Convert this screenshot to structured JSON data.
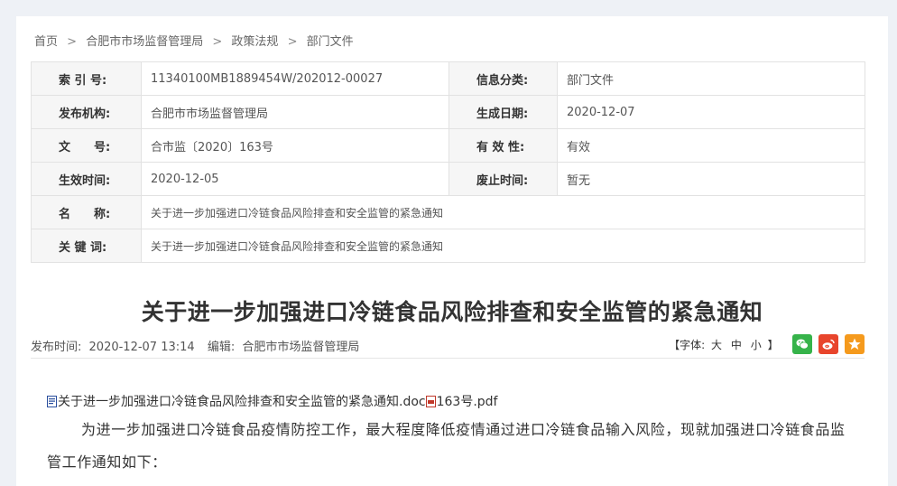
{
  "breadcrumb": {
    "home": "首页",
    "sep": ">",
    "items": [
      "合肥市市场监督管理局",
      "政策法规",
      "部门文件"
    ]
  },
  "meta": {
    "index_label": "索 引 号:",
    "index_value": "11340100MB1889454W/202012-00027",
    "category_label": "信息分类:",
    "category_value": "部门文件",
    "publisher_label": "发布机构:",
    "publisher_value": "合肥市市场监督管理局",
    "created_label": "生成日期:",
    "created_value": "2020-12-07",
    "docno_label": "文　　号:",
    "docno_value": "合市监〔2020〕163号",
    "validity_label": "有 效 性:",
    "validity_value": "有效",
    "effective_label": "生效时间:",
    "effective_value": "2020-12-05",
    "abolish_label": "废止时间:",
    "abolish_value": "暂无",
    "name_label": "名　　称:",
    "name_value": "关于进一步加强进口冷链食品风险排查和安全监管的紧急通知",
    "keywords_label": "关 键 词:",
    "keywords_value": "关于进一步加强进口冷链食品风险排查和安全监管的紧急通知"
  },
  "article": {
    "title": "关于进一步加强进口冷链食品风险排查和安全监管的紧急通知",
    "publish_label": "发布时间:",
    "publish_time": "2020-12-07 13:14",
    "editor_label": "编辑:",
    "editor": "合肥市市场监督管理局",
    "font_label": "【字体:",
    "font_large": "大",
    "font_medium": "中",
    "font_small": "小",
    "font_close": "】",
    "attachment_doc": "关于进一步加强进口冷链食品风险排查和安全监管的紧急通知.doc",
    "attachment_pdf": "163号.pdf",
    "paragraph": "为进一步加强进口冷链食品疫情防控工作，最大程度降低疫情通过进口冷链食品输入风险，现就加强进口冷链食品监管工作通知如下："
  },
  "icons": {
    "wechat": "wechat-share-icon",
    "weibo": "weibo-share-icon",
    "favorite": "favorite-star-icon",
    "doc": "doc-file-icon",
    "pdf": "pdf-file-icon"
  },
  "colors": {
    "wechat": "#36b34a",
    "weibo": "#e8452c",
    "favorite": "#f59a1d"
  }
}
